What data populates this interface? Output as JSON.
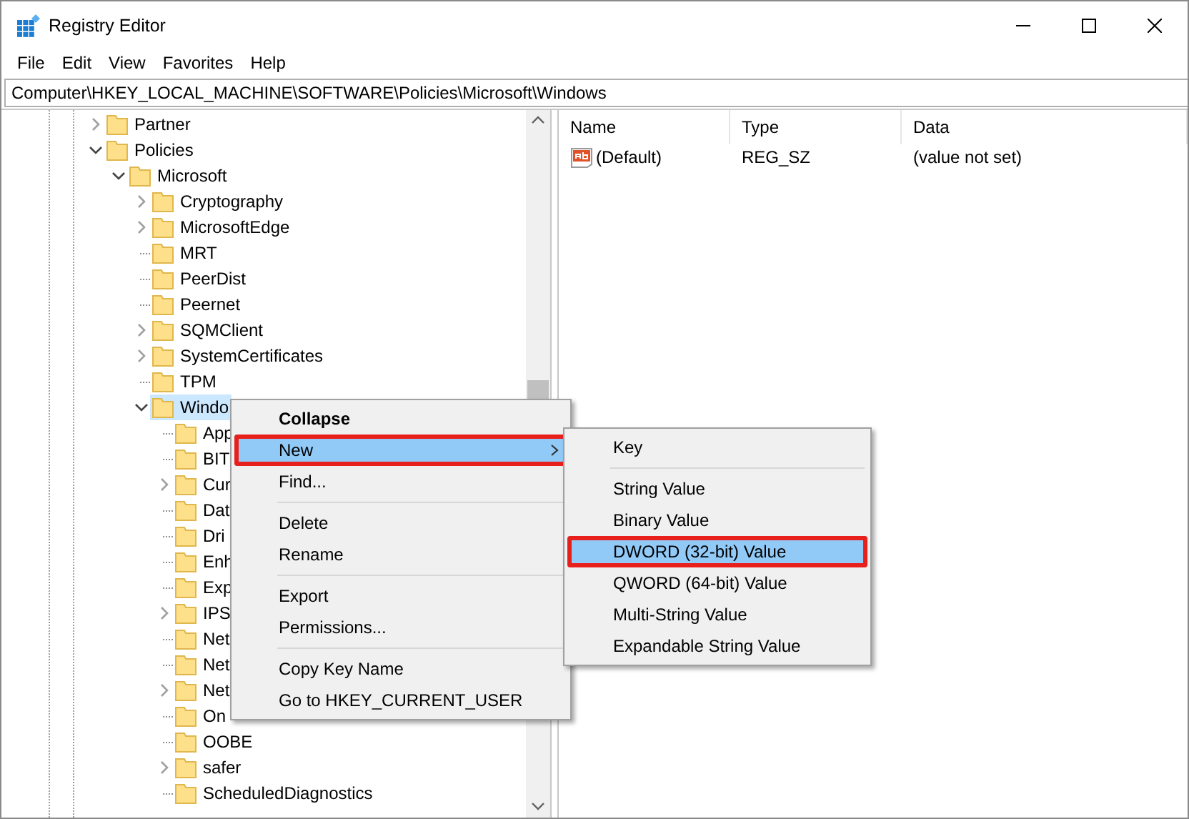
{
  "window": {
    "title": "Registry Editor"
  },
  "menu_bar": [
    "File",
    "Edit",
    "View",
    "Favorites",
    "Help"
  ],
  "address": "Computer\\HKEY_LOCAL_MACHINE\\SOFTWARE\\Policies\\Microsoft\\Windows",
  "tree": [
    {
      "label": "Partner",
      "kind": "branch",
      "expanded": false,
      "selected": false
    },
    {
      "label": "Policies",
      "kind": "branch",
      "expanded": true,
      "selected": false,
      "children": [
        {
          "label": "Microsoft",
          "kind": "branch",
          "expanded": true,
          "selected": false,
          "children": [
            {
              "label": "Cryptography",
              "kind": "branch",
              "expanded": false,
              "selected": false
            },
            {
              "label": "MicrosoftEdge",
              "kind": "branch",
              "expanded": false,
              "selected": false
            },
            {
              "label": "MRT",
              "kind": "leaf",
              "selected": false
            },
            {
              "label": "PeerDist",
              "kind": "leaf",
              "selected": false
            },
            {
              "label": "Peernet",
              "kind": "leaf",
              "selected": false
            },
            {
              "label": "SQMClient",
              "kind": "branch",
              "expanded": false,
              "selected": false
            },
            {
              "label": "SystemCertificates",
              "kind": "branch",
              "expanded": false,
              "selected": false
            },
            {
              "label": "TPM",
              "kind": "leaf",
              "selected": false
            },
            {
              "label": "Windo",
              "kind": "branch",
              "expanded": true,
              "selected": true,
              "children": [
                {
                  "label": "App",
                  "kind": "leaf",
                  "selected": false
                },
                {
                  "label": "BIT",
                  "kind": "leaf",
                  "selected": false
                },
                {
                  "label": "Cur",
                  "kind": "branch",
                  "expanded": false,
                  "selected": false
                },
                {
                  "label": "Dat",
                  "kind": "leaf",
                  "selected": false
                },
                {
                  "label": "Dri",
                  "kind": "leaf",
                  "selected": false
                },
                {
                  "label": "Enh",
                  "kind": "leaf",
                  "selected": false
                },
                {
                  "label": "Exp",
                  "kind": "leaf",
                  "selected": false
                },
                {
                  "label": "IPS",
                  "kind": "branch",
                  "expanded": false,
                  "selected": false
                },
                {
                  "label": "Net",
                  "kind": "leaf",
                  "selected": false
                },
                {
                  "label": "Net",
                  "kind": "leaf",
                  "selected": false
                },
                {
                  "label": "Net",
                  "kind": "branch",
                  "expanded": false,
                  "selected": false
                },
                {
                  "label": "On",
                  "kind": "leaf",
                  "selected": false
                },
                {
                  "label": "OOBE",
                  "kind": "leaf",
                  "selected": false
                },
                {
                  "label": "safer",
                  "kind": "branch",
                  "expanded": false,
                  "selected": false
                },
                {
                  "label": "ScheduledDiagnostics",
                  "kind": "leaf",
                  "selected": false
                }
              ]
            }
          ]
        }
      ]
    }
  ],
  "values": {
    "columns": [
      "Name",
      "Type",
      "Data"
    ],
    "rows": [
      {
        "name": "(Default)",
        "type": "REG_SZ",
        "data": "(value not set)"
      }
    ]
  },
  "context_menu": [
    {
      "kind": "item",
      "label": "Collapse",
      "default": true,
      "selected": false,
      "submenu": false
    },
    {
      "kind": "item",
      "label": "New",
      "default": false,
      "selected": true,
      "submenu": true
    },
    {
      "kind": "item",
      "label": "Find...",
      "default": false,
      "selected": false,
      "submenu": false
    },
    {
      "kind": "separator"
    },
    {
      "kind": "item",
      "label": "Delete",
      "default": false,
      "selected": false,
      "submenu": false
    },
    {
      "kind": "item",
      "label": "Rename",
      "default": false,
      "selected": false,
      "submenu": false
    },
    {
      "kind": "separator"
    },
    {
      "kind": "item",
      "label": "Export",
      "default": false,
      "selected": false,
      "submenu": false
    },
    {
      "kind": "item",
      "label": "Permissions...",
      "default": false,
      "selected": false,
      "submenu": false
    },
    {
      "kind": "separator"
    },
    {
      "kind": "item",
      "label": "Copy Key Name",
      "default": false,
      "selected": false,
      "submenu": false
    },
    {
      "kind": "item",
      "label": "Go to HKEY_CURRENT_USER",
      "default": false,
      "selected": false,
      "submenu": false
    }
  ],
  "submenu": [
    {
      "kind": "item",
      "label": "Key",
      "selected": false
    },
    {
      "kind": "separator"
    },
    {
      "kind": "item",
      "label": "String Value",
      "selected": false
    },
    {
      "kind": "item",
      "label": "Binary Value",
      "selected": false
    },
    {
      "kind": "item",
      "label": "DWORD (32-bit) Value",
      "selected": true
    },
    {
      "kind": "item",
      "label": "QWORD (64-bit) Value",
      "selected": false
    },
    {
      "kind": "item",
      "label": "Multi-String Value",
      "selected": false
    },
    {
      "kind": "item",
      "label": "Expandable String Value",
      "selected": false
    }
  ]
}
